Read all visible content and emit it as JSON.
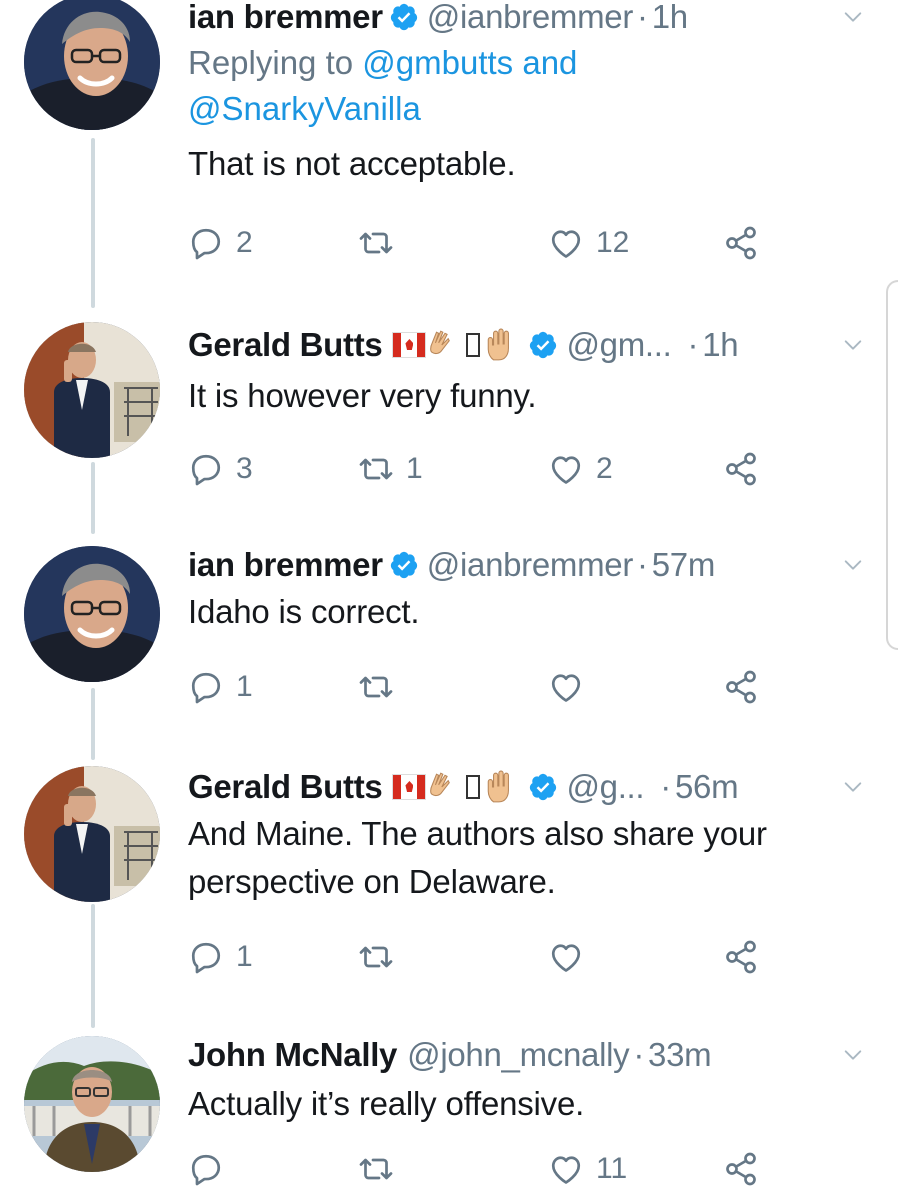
{
  "tweets": [
    {
      "name": "ian bremmer",
      "verified": true,
      "handle": "@ianbremmer",
      "time": "1h",
      "reply_prefix": "Replying to",
      "reply_link1": "@gmbutts and",
      "reply_link2": "@SnarkyVanilla",
      "text": "That is not acceptable.",
      "replies": "2",
      "retweets": "",
      "likes": "12",
      "avatar_icon": "avatar-ian-bremmer"
    },
    {
      "name": "Gerald Butts",
      "verified": true,
      "handle": "@gm...",
      "time": "1h",
      "text": "It is however very funny.",
      "replies": "3",
      "retweets": "1",
      "likes": "2",
      "avatar_icon": "avatar-gerald-butts"
    },
    {
      "name": "ian bremmer",
      "verified": true,
      "handle": "@ianbremmer",
      "time": "57m",
      "text": "Idaho is correct.",
      "replies": "1",
      "retweets": "",
      "likes": "",
      "avatar_icon": "avatar-ian-bremmer"
    },
    {
      "name": "Gerald Butts",
      "verified": true,
      "handle": "@g...",
      "time": "56m",
      "text_line1": "And Maine. The authors also share your",
      "text_line2": "perspective on Delaware.",
      "replies": "1",
      "retweets": "",
      "likes": "",
      "avatar_icon": "avatar-gerald-butts"
    },
    {
      "name": "John McNally",
      "verified": false,
      "handle": "@john_mcnally",
      "time": "33m",
      "text": "Actually it’s really offensive.",
      "replies": "",
      "retweets": "",
      "likes": "11",
      "avatar_icon": "avatar-john-mcnally"
    }
  ],
  "separator": "·",
  "colors": {
    "verified": "#1da1f2",
    "icon_gray": "#657786",
    "link": "#1b95e0",
    "thread_line": "#cfd9de"
  }
}
